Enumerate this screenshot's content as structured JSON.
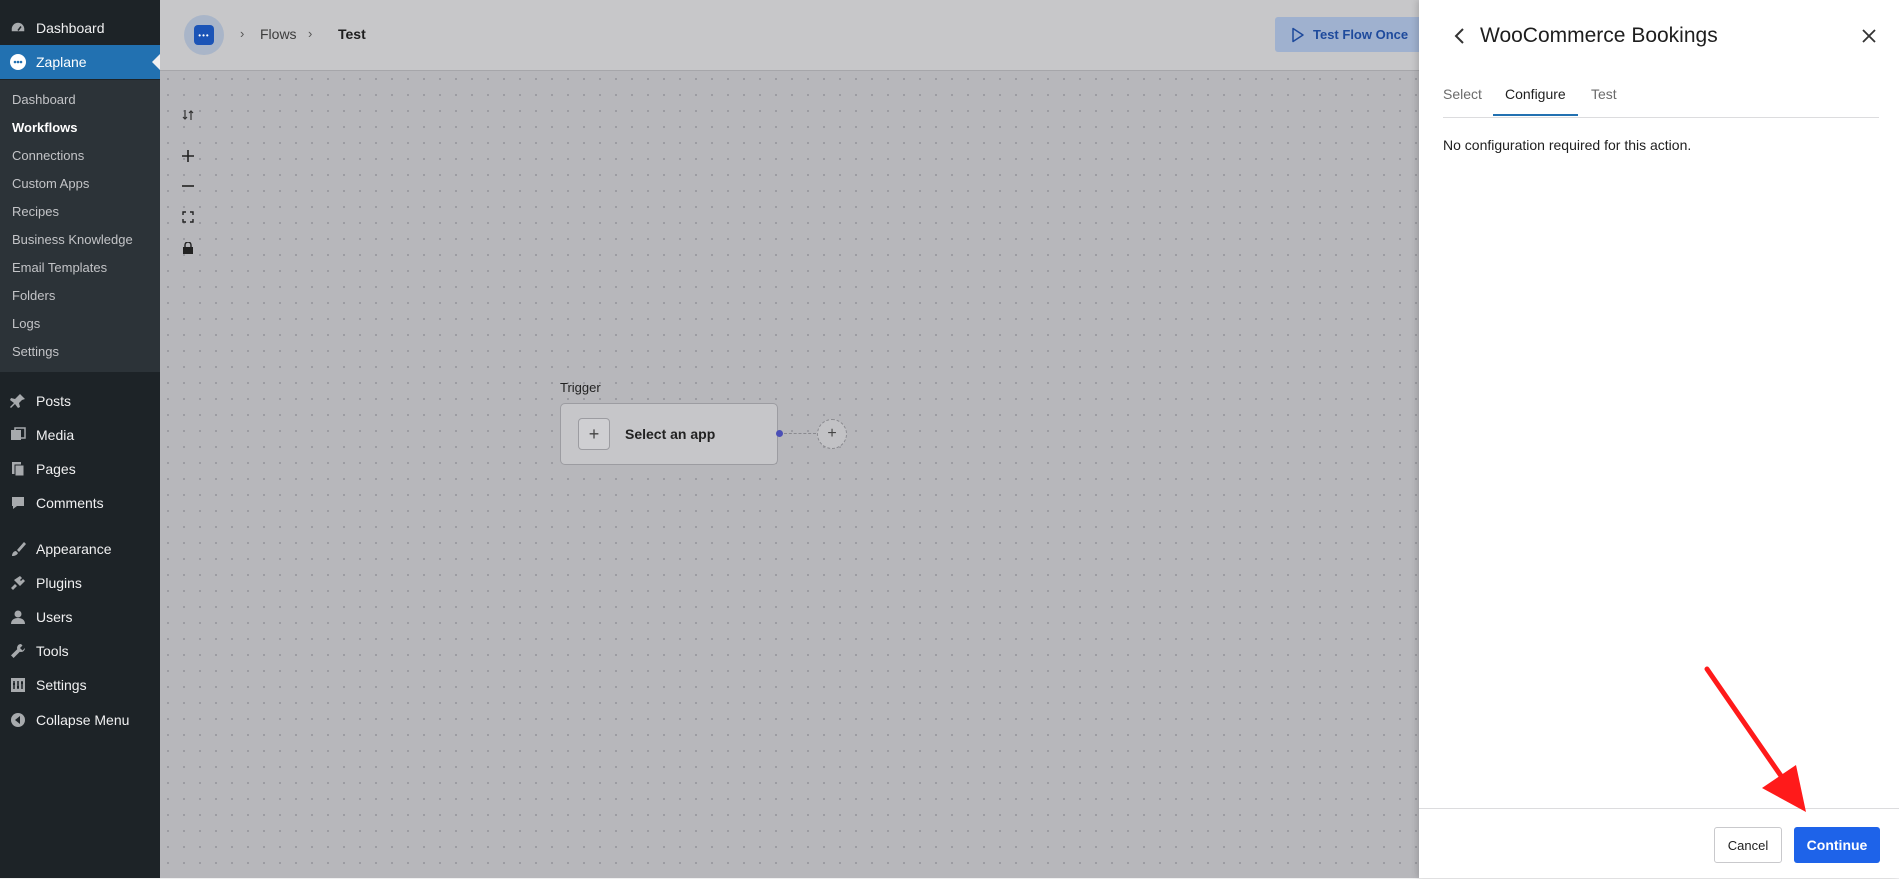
{
  "wp_sidebar": {
    "items": [
      {
        "label": "Dashboard",
        "icon": "dashboard-icon"
      },
      {
        "label": "Zaplane",
        "icon": "zaplane-icon",
        "active": true
      },
      {
        "label": "Posts",
        "icon": "pin-icon"
      },
      {
        "label": "Media",
        "icon": "media-icon"
      },
      {
        "label": "Pages",
        "icon": "pages-icon"
      },
      {
        "label": "Comments",
        "icon": "comment-icon"
      },
      {
        "label": "Appearance",
        "icon": "brush-icon"
      },
      {
        "label": "Plugins",
        "icon": "plugin-icon"
      },
      {
        "label": "Users",
        "icon": "user-icon"
      },
      {
        "label": "Tools",
        "icon": "wrench-icon"
      },
      {
        "label": "Settings",
        "icon": "settings-icon"
      },
      {
        "label": "Collapse Menu",
        "icon": "collapse-icon"
      }
    ],
    "submenu": [
      {
        "label": "Dashboard"
      },
      {
        "label": "Workflows",
        "current": true
      },
      {
        "label": "Connections"
      },
      {
        "label": "Custom Apps"
      },
      {
        "label": "Recipes"
      },
      {
        "label": "Business Knowledge"
      },
      {
        "label": "Email Templates"
      },
      {
        "label": "Folders"
      },
      {
        "label": "Logs"
      },
      {
        "label": "Settings"
      }
    ]
  },
  "header": {
    "breadcrumbs": [
      "Flows",
      "Test"
    ],
    "test_flow_label": "Test Flow Once"
  },
  "canvas": {
    "trigger_label": "Trigger",
    "trigger_node_text": "Select an app"
  },
  "panel": {
    "title": "WooCommerce Bookings",
    "tabs": [
      {
        "label": "Select"
      },
      {
        "label": "Configure",
        "active": true
      },
      {
        "label": "Test"
      }
    ],
    "message": "No configuration required for this action.",
    "cancel_label": "Cancel",
    "continue_label": "Continue"
  },
  "colors": {
    "wp_sidebar_bg": "#1d2327",
    "wp_active": "#2271b1",
    "primary_button": "#1e63e9",
    "annotation_arrow": "#ff1a1a"
  }
}
